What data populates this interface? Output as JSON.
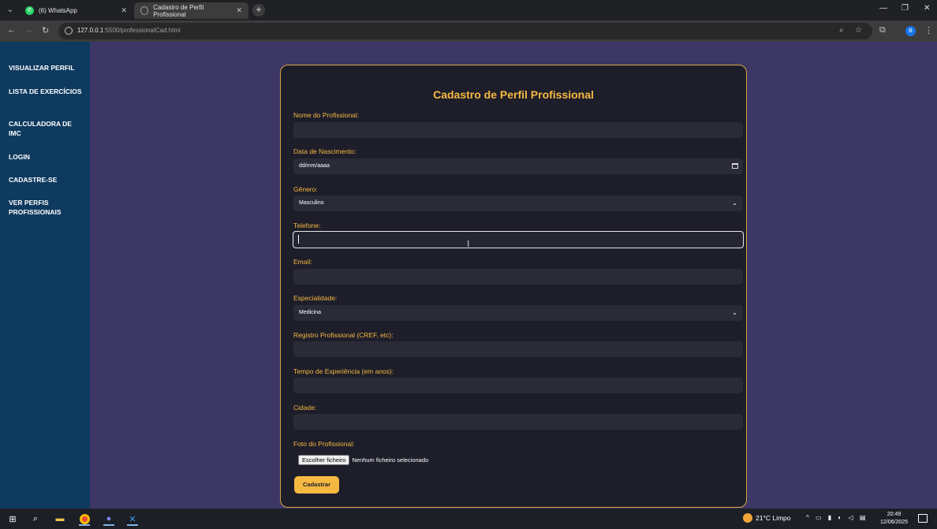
{
  "browser": {
    "tabs": [
      {
        "label": "(6) WhatsApp",
        "icon": "whatsapp-icon"
      },
      {
        "label": "Cadastro de Perfil Profissional",
        "icon": "globe-icon"
      }
    ],
    "url_host": "127.0.0.1",
    "url_rest": ":5500/professionalCad.html"
  },
  "sidebar": {
    "items": [
      {
        "label": "VISUALIZAR PERFIL"
      },
      {
        "label": "LISTA DE EXERCÍCIOS"
      },
      {
        "label": "CALCULADORA DE IMC"
      },
      {
        "label": "LOGIN"
      },
      {
        "label": "CADASTRE-SE"
      },
      {
        "label": "VER PERFIS PROFISSIONAIS"
      }
    ]
  },
  "form": {
    "title": "Cadastro de Perfil Profissional",
    "nome_label": "Nome do Profissional:",
    "nascimento_label": "Data de Nascimento:",
    "nascimento_value": "dd/mm/aaaa",
    "genero_label": "Gênero:",
    "genero_value": "Masculino",
    "telefone_label": "Telefone:",
    "email_label": "Email:",
    "especialidade_label": "Especialidade:",
    "especialidade_value": "Medicina",
    "registro_label": "Registro Profissional (CREF, etc):",
    "experiencia_label": "Tempo de Experiência (em anos):",
    "cidade_label": "Cidade:",
    "foto_label": "Foto do Profissional:",
    "file_button": "Escolher ficheiro",
    "file_status": "Nenhum ficheiro selecionado",
    "submit_label": "Cadastrar"
  },
  "taskbar": {
    "weather": "21°C  Limpo",
    "time": "20:49",
    "date": "12/06/2025"
  },
  "colors": {
    "accent": "#f5b942",
    "sidebar_bg": "#0f3a5f",
    "page_bg": "#3d3766",
    "card_bg": "#1e1e2a"
  }
}
